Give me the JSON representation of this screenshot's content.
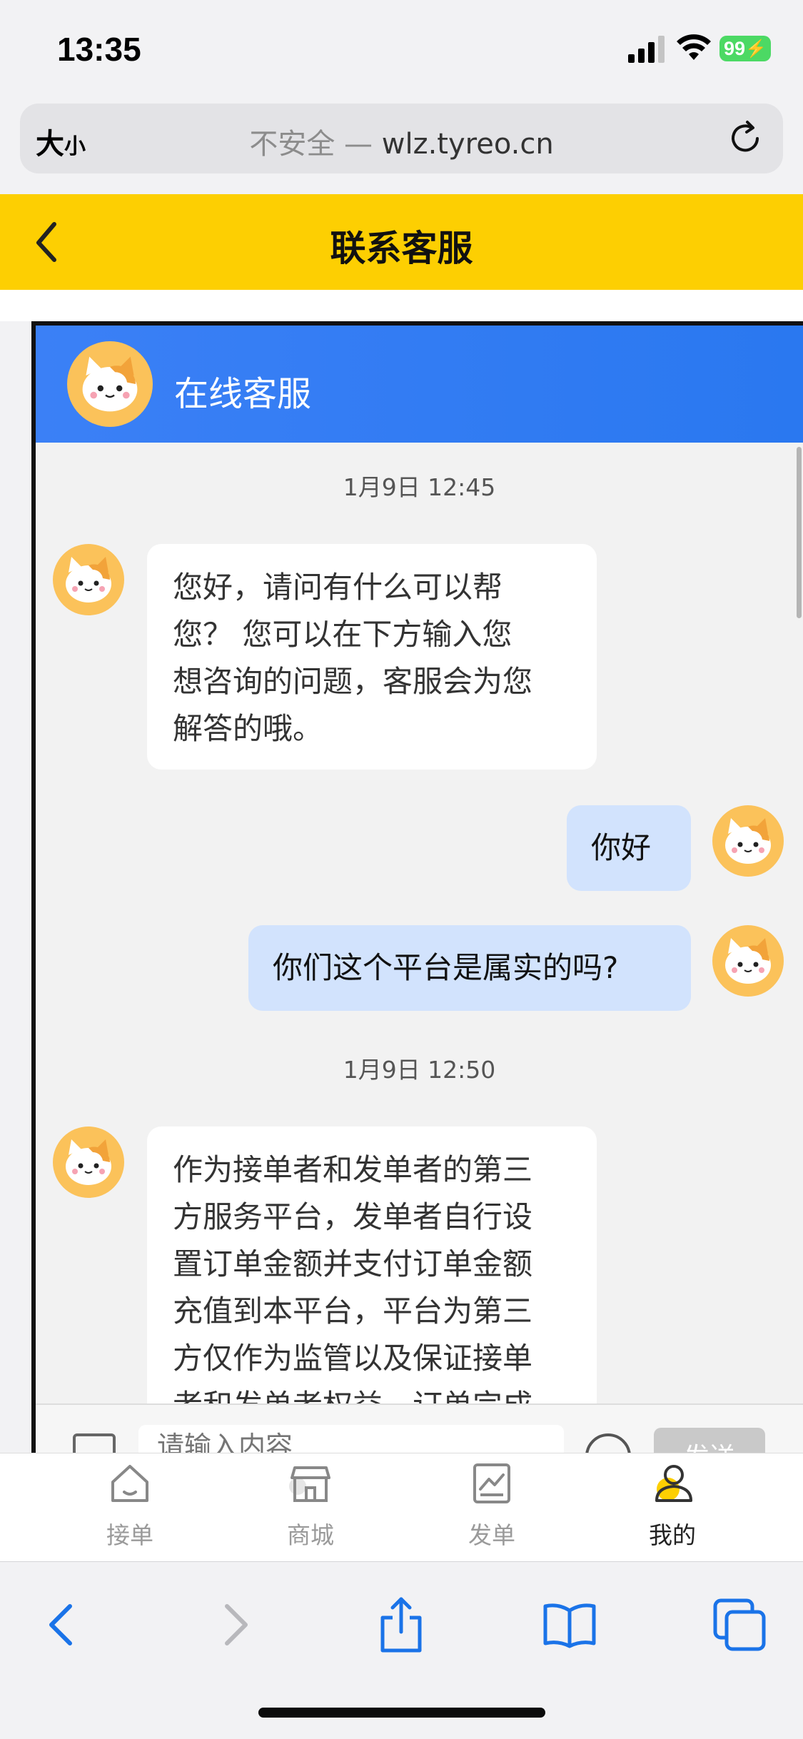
{
  "status_bar": {
    "time": "13:35",
    "battery": "99"
  },
  "browser": {
    "text_size_big": "大",
    "text_size_small": "小",
    "insecure_label": "不安全 —",
    "domain": "wlz.tyreo.cn"
  },
  "header": {
    "title": "联系客服"
  },
  "chat": {
    "title": "在线客服",
    "messages": [
      {
        "kind": "time",
        "text": "1月9日 12:45"
      },
      {
        "kind": "in",
        "lines": [
          "您好，请问有什么可以帮",
          "您？ 您可以在下方输入您",
          "想咨询的问题，客服会为您",
          "解答的哦。"
        ]
      },
      {
        "kind": "out",
        "text": "你好"
      },
      {
        "kind": "out",
        "text": "你们这个平台是属实的吗?"
      },
      {
        "kind": "time",
        "text": "1月9日 12:50"
      },
      {
        "kind": "in",
        "lines": [
          "作为接单者和发单者的第三",
          "方服务平台，发单者自行设",
          "置订单金额并支付订单金额",
          "充值到本平台，平台为第三",
          "方仅作为监管以及保证接单",
          "者和发单者权益，订单完成"
        ]
      }
    ],
    "input_placeholder": "请输入内容",
    "send_label": "发送"
  },
  "tabs": [
    {
      "label": "接单",
      "icon": "home-icon",
      "active": false
    },
    {
      "label": "商城",
      "icon": "shop-icon",
      "active": false
    },
    {
      "label": "发单",
      "icon": "chart-icon",
      "active": false
    },
    {
      "label": "我的",
      "icon": "user-icon",
      "active": true
    }
  ],
  "colors": {
    "header": "#fdcf02",
    "chat_header": "#3b80f6",
    "out_bubble": "#d2e3fd",
    "safari_blue": "#1a73e8"
  }
}
